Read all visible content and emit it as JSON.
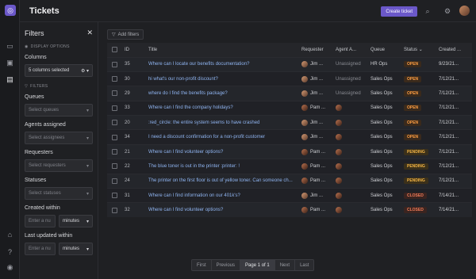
{
  "header": {
    "title": "Tickets",
    "create_label": "Create ticket"
  },
  "filters": {
    "title": "Filters",
    "display_options_label": "DISPLAY OPTIONS",
    "columns_label": "Columns",
    "columns_value": "5 columns selected",
    "filters_section": "FILTERS",
    "queues_label": "Queues",
    "queues_placeholder": "Select queues",
    "agents_label": "Agents assigned",
    "agents_placeholder": "Select assignees",
    "requesters_label": "Requesters",
    "requesters_placeholder": "Select requesters",
    "statuses_label": "Statuses",
    "statuses_placeholder": "Select statuses",
    "created_within_label": "Created within",
    "created_within_placeholder": "Enter a nu",
    "created_within_unit": "minutes",
    "updated_within_label": "Last updated within",
    "updated_within_placeholder": "Enter a nu",
    "updated_within_unit": "minutes"
  },
  "toolbar": {
    "add_filters_label": "Add filters"
  },
  "table": {
    "headers": {
      "id": "ID",
      "title": "Title",
      "requester": "Requester",
      "agent": "Agent A...",
      "queue": "Queue",
      "status": "Status",
      "created": "Created ..."
    },
    "rows": [
      {
        "id": "35",
        "title": "Where can I locate our benefits documentation?",
        "requester": "Jim ...",
        "agent": "Unassigned",
        "queue": "HR Ops",
        "status": "OPEN",
        "created": "9/23/21..."
      },
      {
        "id": "30",
        "title": "hi what's our non-profit discount?",
        "requester": "Jim ...",
        "agent": "Unassigned",
        "queue": "Sales Ops",
        "status": "OPEN",
        "created": "7/12/21..."
      },
      {
        "id": "29",
        "title": "where do I find the benefits package?",
        "requester": "Jim ...",
        "agent": "Unassigned",
        "queue": "Sales Ops",
        "status": "OPEN",
        "created": "7/12/21..."
      },
      {
        "id": "33",
        "title": "Where can I find the company holidays?",
        "requester": "Pam ...",
        "agent": "",
        "queue": "Sales Ops",
        "status": "OPEN",
        "created": "7/12/21..."
      },
      {
        "id": "20",
        "title": ":red_circle: the entire system seems to have crashed",
        "requester": "Jim ...",
        "agent": "",
        "queue": "Sales Ops",
        "status": "OPEN",
        "created": "7/12/21..."
      },
      {
        "id": "34",
        "title": "I need a discount confirmation for a non-profit customer",
        "requester": "Jim ...",
        "agent": "",
        "queue": "Sales Ops",
        "status": "OPEN",
        "created": "7/12/21..."
      },
      {
        "id": "21",
        "title": "Where can I find volunteer options?",
        "requester": "Pam ...",
        "agent": "",
        "queue": "Sales Ops",
        "status": "PENDING",
        "created": "7/12/21..."
      },
      {
        "id": "22",
        "title": "The blue toner is out in the printer :printer: !",
        "requester": "Pam ...",
        "agent": "",
        "queue": "Sales Ops",
        "status": "PENDING",
        "created": "7/12/21..."
      },
      {
        "id": "24",
        "title": "The printer on the first floor is out of yellow toner. Can someone ch...",
        "requester": "Pam ...",
        "agent": "",
        "queue": "Sales Ops",
        "status": "PENDING",
        "created": "7/12/21..."
      },
      {
        "id": "31",
        "title": "Where can I find information on our 401k's?",
        "requester": "Jim ...",
        "agent": "",
        "queue": "Sales Ops",
        "status": "CLOSED",
        "created": "7/14/21..."
      },
      {
        "id": "32",
        "title": "Where can I find volunteer options?",
        "requester": "Pam ...",
        "agent": "",
        "queue": "Sales Ops",
        "status": "CLOSED",
        "created": "7/14/21..."
      }
    ]
  },
  "pagination": {
    "first": "First",
    "previous": "Previous",
    "current": "Page 1 of 1",
    "next": "Next",
    "last": "Last"
  }
}
